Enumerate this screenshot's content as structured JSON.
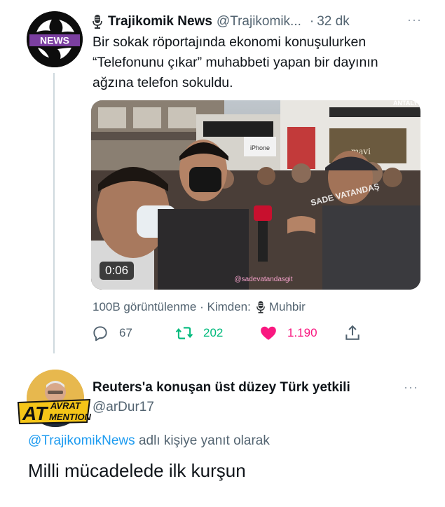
{
  "tweet": {
    "author_name": "Trajikomik News",
    "author_handle": "@Trajikomik...",
    "time": "32 dk",
    "more": "···",
    "text": "Bir sokak röportajında ekonomi konuşulurken “Telefonunu çıkar” muhabbeti yapan bir dayının ağzına telefon sokuldu.",
    "avatar_text": "NEWS",
    "media": {
      "duration": "0:06",
      "sign_text": "ANTALY",
      "sign_iphone": "iPhone",
      "sign_mavi": "mavi",
      "watermark": "SADE VATANDAŞ",
      "credit": "@sadevatandasgit"
    },
    "views_text": "100B görüntülenme · Kimden:",
    "source_name": "Muhbir",
    "actions": {
      "replies": "67",
      "retweets": "202",
      "likes": "1.190"
    }
  },
  "reply": {
    "author_name": "Reuters'a konuşan üst düzey Türk yetkili",
    "author_handle": "@arDur17",
    "more": "···",
    "badge_top": "AVRAT",
    "badge_left": "AT",
    "badge_bottom": "MENTION",
    "replying_mention": "@TrajikomikNews",
    "replying_suffix": "adlı kişiye yanıt olarak",
    "text": "Milli mücadelede ilk kurşun"
  },
  "colors": {
    "accent": "#1d9bf0",
    "retweet": "#00ba7c",
    "like": "#f91880",
    "secondary_text": "#536471"
  }
}
